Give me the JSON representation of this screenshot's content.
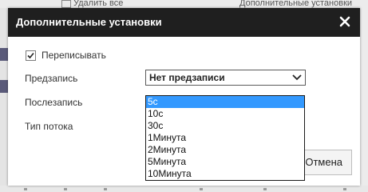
{
  "background": {
    "delete_all_label": "Удалить все",
    "advanced_settings_label": "Дополнительные установки"
  },
  "dialog": {
    "title": "Дополнительные установки",
    "overwrite_checked": true,
    "overwrite_label": "Переписывать",
    "prerecord_label": "Предзапись",
    "prerecord_value": "Нет предзаписи",
    "postrecord_label": "Послезапись",
    "stream_type_label": "Тип потока",
    "postrecord_options": [
      "5с",
      "10с",
      "30с",
      "1Минута",
      "2Минута",
      "5Минута",
      "10Минута"
    ],
    "postrecord_selected_index": 0,
    "cancel_label": "Отмена"
  },
  "icons": {
    "close": "close-icon",
    "check": "checkmark-icon",
    "chevron": "chevron-down-icon",
    "delete": "delete-icon"
  },
  "colors": {
    "header_bg": "#1f1f1f",
    "selected_option_bg": "#3399ff"
  }
}
